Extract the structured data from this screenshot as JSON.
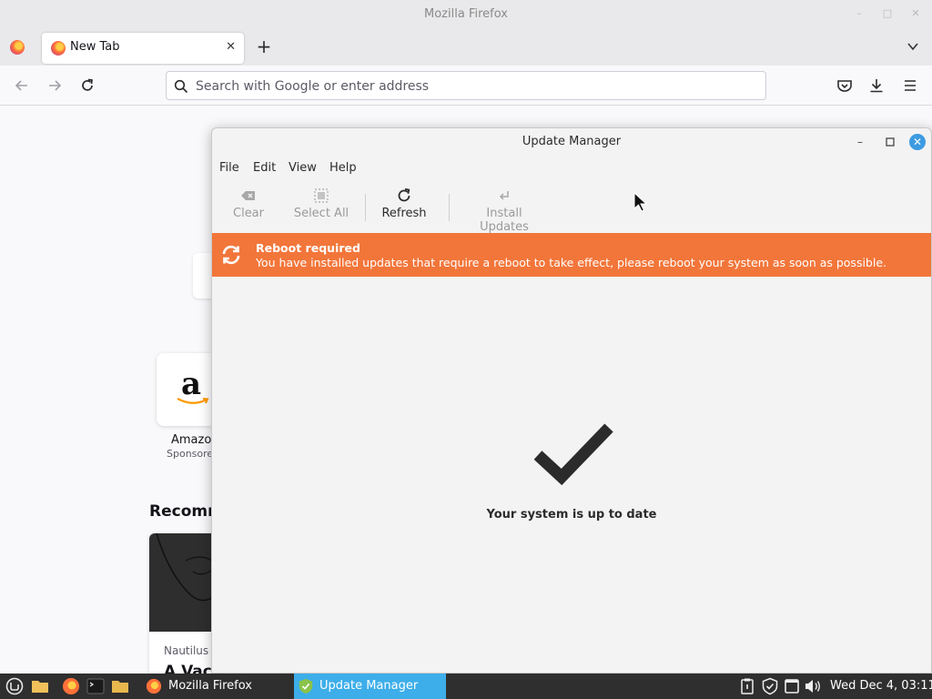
{
  "firefox": {
    "window_title": "Mozilla Firefox",
    "tab_label": "New Tab",
    "url_placeholder": "Search with Google or enter address",
    "shortcut_name": "Amazon",
    "shortcut_sponsored": "Sponsored",
    "recommended_heading": "Recommended by Pocket",
    "card_source": "Nautilus",
    "card_headline": "A Vacc..."
  },
  "update_manager": {
    "title": "Update Manager",
    "menu": [
      "File",
      "Edit",
      "View",
      "Help"
    ],
    "toolbar": {
      "clear": "Clear",
      "select_all": "Select All",
      "refresh": "Refresh",
      "install_updates": "Install Updates"
    },
    "banner": {
      "title": "Reboot required",
      "message": "You have installed updates that require a reboot to take effect, please reboot your system as soon as possible.",
      "color": "#f2763a"
    },
    "status": "Your system is up to date"
  },
  "taskbar": {
    "tasks": [
      "Mozilla Firefox",
      "Update Manager"
    ],
    "clock": "Wed Dec 4, 03:11",
    "active_color": "#3daee9"
  }
}
